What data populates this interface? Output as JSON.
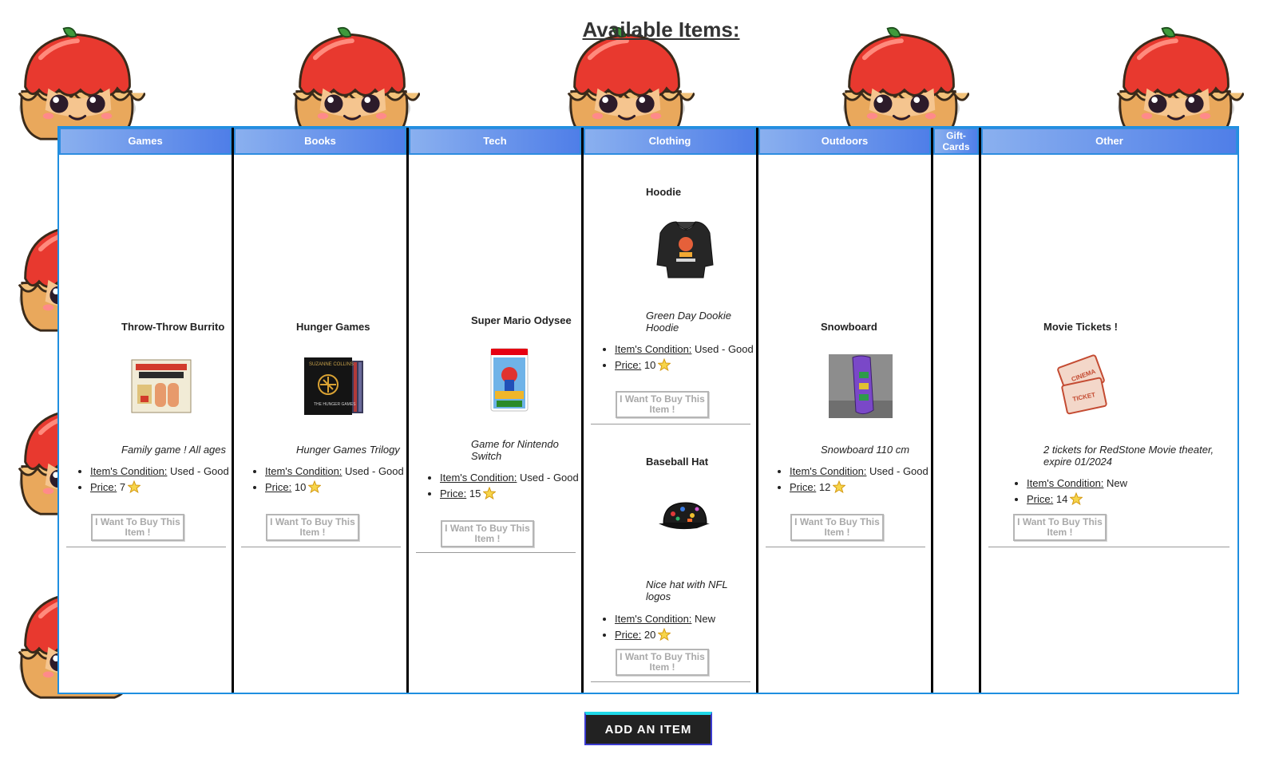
{
  "page": {
    "title": "Available Items:"
  },
  "columns": [
    {
      "label": "Games"
    },
    {
      "label": "Books"
    },
    {
      "label": "Tech"
    },
    {
      "label": "Clothing"
    },
    {
      "label": "Outdoors"
    },
    {
      "label": "Gift-Cards"
    },
    {
      "label": "Other"
    }
  ],
  "common": {
    "condition_label": "Item's Condition:",
    "price_label": "Price:",
    "buy_button": "I Want To Buy This Item !",
    "currency_icon": "star-icon"
  },
  "items": {
    "games": [
      {
        "name": "Throw-Throw Burrito",
        "description": "Family game ! All ages",
        "condition": "Used - Good",
        "price": "7",
        "image": "burrito-game-box"
      }
    ],
    "books": [
      {
        "name": "Hunger Games",
        "description": "Hunger Games Trilogy",
        "condition": "Used - Good",
        "price": "10",
        "image": "hunger-games-box-set"
      }
    ],
    "tech": [
      {
        "name": "Super Mario Odysee",
        "description": "Game for Nintendo Switch",
        "condition": "Used - Good",
        "price": "15",
        "image": "mario-odyssey-case"
      }
    ],
    "clothing": [
      {
        "name": "Hoodie",
        "description": "Green Day Dookie Hoodie",
        "condition": "Used - Good",
        "price": "10",
        "image": "black-hoodie"
      },
      {
        "name": "Baseball Hat",
        "description": "Nice hat with NFL logos",
        "condition": "New",
        "price": "20",
        "image": "black-cap"
      }
    ],
    "outdoors": [
      {
        "name": "Snowboard",
        "description": "Snowboard 110 cm",
        "condition": "Used - Good",
        "price": "12",
        "image": "purple-snowboard"
      }
    ],
    "other": [
      {
        "name": "Movie Tickets !",
        "description": "2 tickets for RedStone Movie theater, expire 01/2024",
        "condition": "New",
        "price": "14",
        "image": "cinema-tickets"
      }
    ]
  },
  "actions": {
    "add_item": "ADD AN ITEM"
  },
  "colors": {
    "header_gradient_start": "#8ab0ef",
    "header_gradient_end": "#4f7ee8",
    "board_border": "#1f8fe0",
    "add_button_bg": "#222222",
    "add_button_top": "#1fd8e8"
  },
  "background": {
    "mascot": "apple-pie-mascot"
  }
}
